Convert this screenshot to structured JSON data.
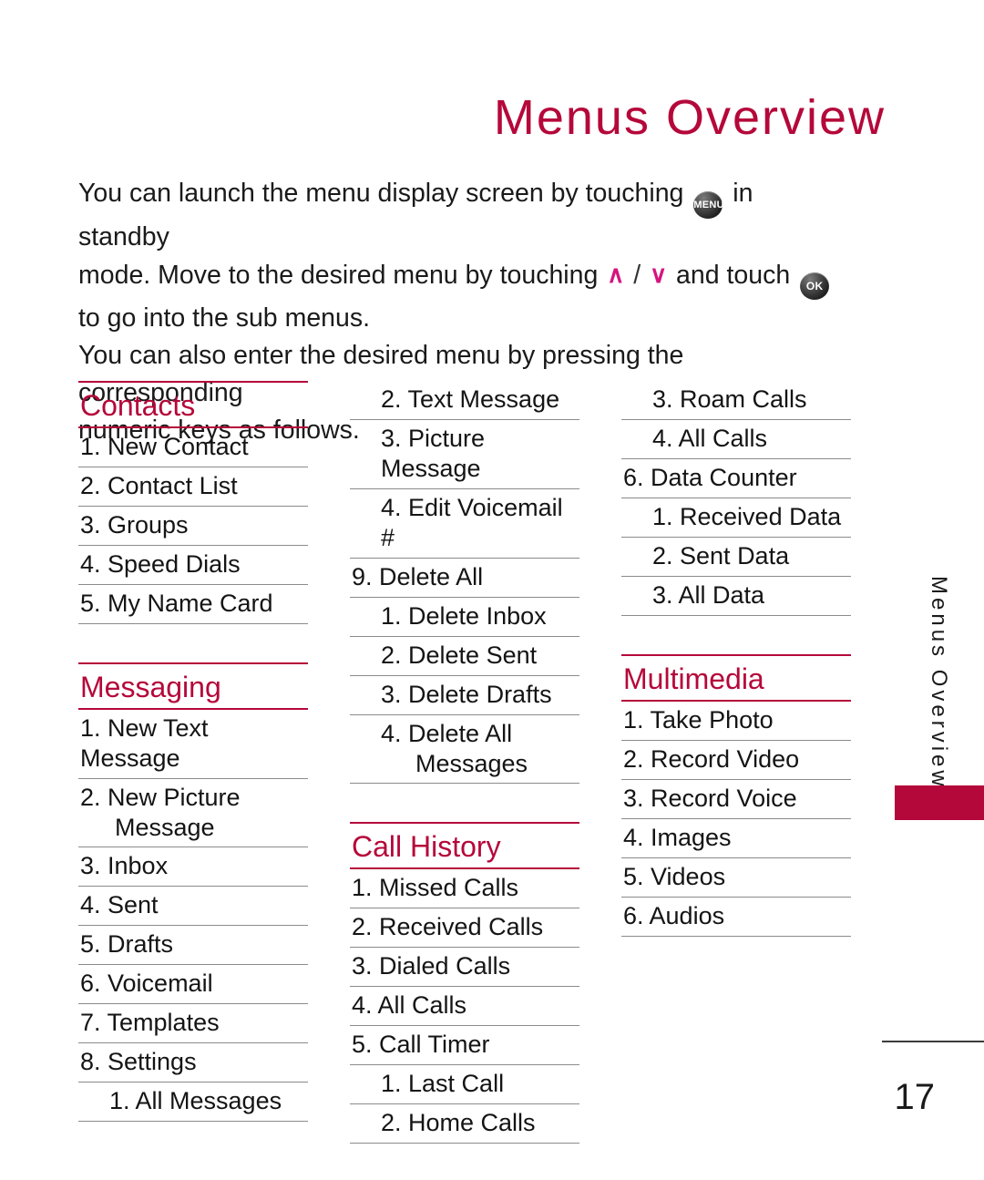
{
  "page": {
    "title": "Menus Overview",
    "number": "17",
    "side_tab_label": "Menus Overview"
  },
  "intro": {
    "line1_a": "You can launch the menu display screen by touching",
    "menu_key_label": "MENU",
    "line1_b": "in standby",
    "line2_a": "mode. Move to the desired menu by touching",
    "up_chevron": "∧",
    "separator": "/",
    "down_chevron": "∨",
    "line2_b": "and touch",
    "ok_key_label": "OK",
    "line3": "to go into the sub menus.",
    "line4": "You can also enter the desired menu by pressing the corresponding",
    "line5": "numeric keys as follows."
  },
  "colors": {
    "accent_red": "#b5083a",
    "chevron_magenta": "#d6147f",
    "rule_gray": "#8b8b8b",
    "text": "#141414"
  },
  "columns": [
    {
      "sections": [
        {
          "heading": "Contacts",
          "items": [
            {
              "label": "1. New Contact",
              "level": 1
            },
            {
              "label": "2. Contact List",
              "level": 1
            },
            {
              "label": "3. Groups",
              "level": 1
            },
            {
              "label": "4. Speed Dials",
              "level": 1
            },
            {
              "label": "5. My Name Card",
              "level": 1
            }
          ]
        },
        {
          "heading": "Messaging",
          "items": [
            {
              "label": "1. New Text Message",
              "level": 1
            },
            {
              "label": "2. New Picture",
              "continuation": "Message",
              "level": 1
            },
            {
              "label": "3. Inbox",
              "level": 1
            },
            {
              "label": "4. Sent",
              "level": 1
            },
            {
              "label": "5. Drafts",
              "level": 1
            },
            {
              "label": "6. Voicemail",
              "level": 1
            },
            {
              "label": "7. Templates",
              "level": 1
            },
            {
              "label": "8. Settings",
              "level": 1
            },
            {
              "label": "1. All Messages",
              "level": 2
            }
          ]
        }
      ]
    },
    {
      "sections": [
        {
          "heading": "",
          "items": [
            {
              "label": "2. Text Message",
              "level": 2
            },
            {
              "label": "3. Picture Message",
              "level": 2
            },
            {
              "label": "4. Edit Voicemail #",
              "level": 2
            },
            {
              "label": "9. Delete All",
              "level": 1
            },
            {
              "label": "1. Delete Inbox",
              "level": 2
            },
            {
              "label": "2. Delete Sent",
              "level": 2
            },
            {
              "label": "3. Delete Drafts",
              "level": 2
            },
            {
              "label": "4. Delete All",
              "continuation": "Messages",
              "level": 2
            }
          ]
        },
        {
          "heading": "Call History",
          "items": [
            {
              "label": "1. Missed Calls",
              "level": 1
            },
            {
              "label": "2. Received Calls",
              "level": 1
            },
            {
              "label": "3. Dialed Calls",
              "level": 1
            },
            {
              "label": "4. All Calls",
              "level": 1
            },
            {
              "label": "5. Call Timer",
              "level": 1
            },
            {
              "label": "1. Last Call",
              "level": 2
            },
            {
              "label": "2. Home Calls",
              "level": 2
            }
          ]
        }
      ]
    },
    {
      "sections": [
        {
          "heading": "",
          "items": [
            {
              "label": "3. Roam Calls",
              "level": 2
            },
            {
              "label": "4. All Calls",
              "level": 2
            },
            {
              "label": "6. Data Counter",
              "level": 1
            },
            {
              "label": "1. Received Data",
              "level": 2
            },
            {
              "label": "2. Sent Data",
              "level": 2
            },
            {
              "label": "3. All Data",
              "level": 2
            }
          ]
        },
        {
          "heading": "Multimedia",
          "items": [
            {
              "label": "1. Take Photo",
              "level": 1
            },
            {
              "label": "2. Record Video",
              "level": 1
            },
            {
              "label": "3. Record Voice",
              "level": 1
            },
            {
              "label": "4. Images",
              "level": 1
            },
            {
              "label": "5. Videos",
              "level": 1
            },
            {
              "label": "6. Audios",
              "level": 1
            }
          ]
        }
      ]
    }
  ]
}
